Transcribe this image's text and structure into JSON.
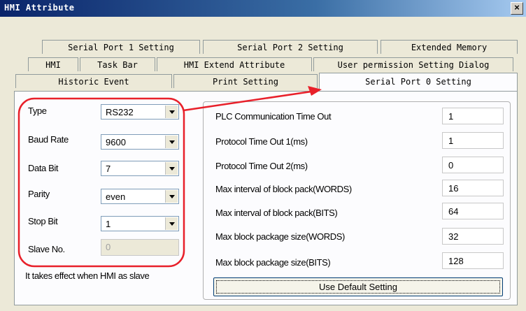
{
  "window": {
    "title": "HMI Attribute",
    "close_glyph": "×"
  },
  "tabs": {
    "row1": [
      "Serial Port 1 Setting",
      "Serial Port 2 Setting",
      "Extended Memory"
    ],
    "row2": [
      "HMI",
      "Task Bar",
      "HMI Extend Attribute",
      "User permission Setting Dialog"
    ],
    "row3": [
      "Historic Event",
      "Print Setting",
      "Serial Port 0 Setting"
    ],
    "active": "Serial Port 0 Setting"
  },
  "left": {
    "type": {
      "label": "Type",
      "value": "RS232"
    },
    "baud_rate": {
      "label": "Baud Rate",
      "value": "9600"
    },
    "data_bit": {
      "label": "Data Bit",
      "value": "7"
    },
    "parity": {
      "label": "Parity",
      "value": "even"
    },
    "stop_bit": {
      "label": "Stop Bit",
      "value": "1"
    },
    "slave_no": {
      "label": "Slave No.",
      "value": "0"
    },
    "note": "It takes effect when HMI as slave"
  },
  "right": {
    "plc_timeout": {
      "label": "PLC Communication Time Out",
      "value": "1"
    },
    "proto_timeout1": {
      "label": "Protocol Time Out 1(ms)",
      "value": "1"
    },
    "proto_timeout2": {
      "label": "Protocol Time Out 2(ms)",
      "value": "0"
    },
    "max_interval_words": {
      "label": "Max interval of block pack(WORDS)",
      "value": "16"
    },
    "max_interval_bits": {
      "label": "Max interval of block pack(BITS)",
      "value": "64"
    },
    "max_size_words": {
      "label": "Max block package size(WORDS)",
      "value": "32"
    },
    "max_size_bits": {
      "label": "Max block package size(BITS)",
      "value": "128"
    },
    "default_button": "Use Default Setting"
  },
  "annotation": {
    "color": "#e8202a"
  }
}
